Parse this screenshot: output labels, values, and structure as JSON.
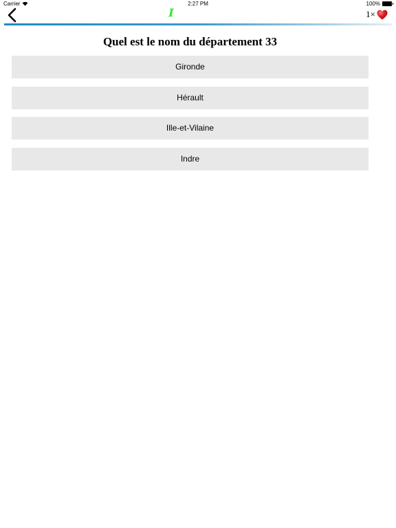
{
  "status_bar": {
    "carrier": "Carrier",
    "time": "2:27 PM",
    "battery": "100%"
  },
  "nav": {
    "logo_text": "I",
    "lives_text": "1×",
    "icons": {
      "back": "chevron-left-icon",
      "lives": "heart-icon",
      "wifi": "wifi-icon",
      "battery": "battery-icon"
    }
  },
  "colors": {
    "logo": "#22ee22",
    "progress": "#1f8bc3",
    "heart": "#e01b24",
    "answer_background": "#e8e8e8"
  },
  "question": "Quel est le nom du département 33",
  "answers": [
    "Gironde",
    "Hérault",
    "Ille-et-Vilaine",
    "Indre"
  ]
}
